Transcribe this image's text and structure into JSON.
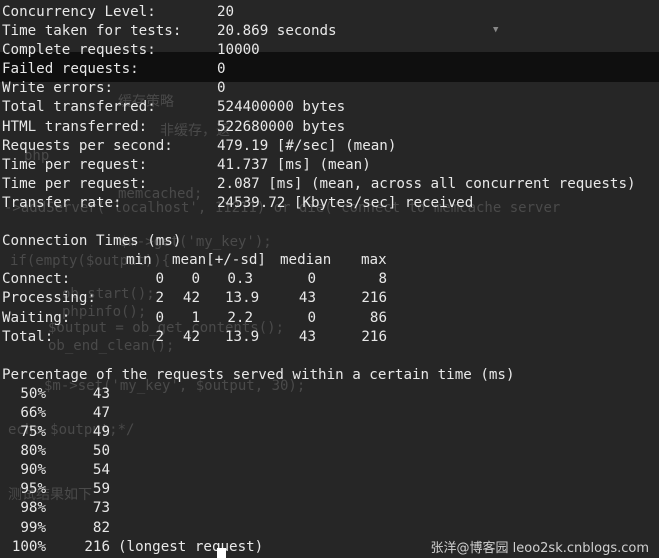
{
  "summary": [
    {
      "label": "Concurrency Level:",
      "value": "20"
    },
    {
      "label": "Time taken for tests:",
      "value": "20.869 seconds"
    },
    {
      "label": "Complete requests:",
      "value": "10000"
    },
    {
      "label": "Failed requests:",
      "value": "0"
    },
    {
      "label": "Write errors:",
      "value": "0"
    },
    {
      "label": "Total transferred:",
      "value": "524400000 bytes"
    },
    {
      "label": "HTML transferred:",
      "value": "522680000 bytes"
    },
    {
      "label": "Requests per second:",
      "value": "479.19 [#/sec] (mean)"
    },
    {
      "label": "Time per request:",
      "value": "41.737 [ms] (mean)"
    },
    {
      "label": "Time per request:",
      "value": "2.087 [ms] (mean, across all concurrent requests)"
    },
    {
      "label": "Transfer rate:",
      "value": "24539.72 [Kbytes/sec] received"
    }
  ],
  "connection_times": {
    "title": "Connection Times (ms)",
    "headers": {
      "min": "min",
      "mean": "mean[+/-sd]",
      "median": "median",
      "max": "max"
    },
    "rows": [
      {
        "label": "Connect:",
        "min": "0",
        "mean": "0",
        "sd": "0.3",
        "median": "0",
        "max": "8"
      },
      {
        "label": "Processing:",
        "min": "2",
        "mean": "42",
        "sd": "13.9",
        "median": "43",
        "max": "216"
      },
      {
        "label": "Waiting:",
        "min": "0",
        "mean": "1",
        "sd": "2.2",
        "median": "0",
        "max": "86"
      },
      {
        "label": "Total:",
        "min": "2",
        "mean": "42",
        "sd": "13.9",
        "median": "43",
        "max": "216"
      }
    ]
  },
  "percentiles": {
    "title": "Percentage of the requests served within a certain time (ms)",
    "rows": [
      {
        "pct": "50%",
        "ms": "43",
        "note": ""
      },
      {
        "pct": "66%",
        "ms": "47",
        "note": ""
      },
      {
        "pct": "75%",
        "ms": "49",
        "note": ""
      },
      {
        "pct": "80%",
        "ms": "50",
        "note": ""
      },
      {
        "pct": "90%",
        "ms": "54",
        "note": ""
      },
      {
        "pct": "95%",
        "ms": "59",
        "note": ""
      },
      {
        "pct": "98%",
        "ms": "73",
        "note": ""
      },
      {
        "pct": "99%",
        "ms": "82",
        "note": ""
      },
      {
        "pct": "100%",
        "ms": "216",
        "note": "(longest request)"
      }
    ]
  },
  "background_ghost": {
    "line1": "(longest request)",
    "line2": "缓存策略",
    "line3": "非缓存，返",
    "line4": "php",
    "line5": "memcached;",
    "line6": "->addServer('localhost', 11211) or die('connect to memcache server",
    "line7": "$m->get('my_key');",
    "line8": "if(empty($output)){",
    "line9": "ob_start();",
    "line10": "phpinfo();",
    "line11": "$output = ob_get_contents();",
    "line12": "ob_end_clean();",
    "line13": "$m->set('my_key', $output, 30);",
    "line14": "echo $output;*/",
    "line15": "测试结果如下"
  },
  "watermark": "张洋@博客园 leoo2sk.cnblogs.com"
}
